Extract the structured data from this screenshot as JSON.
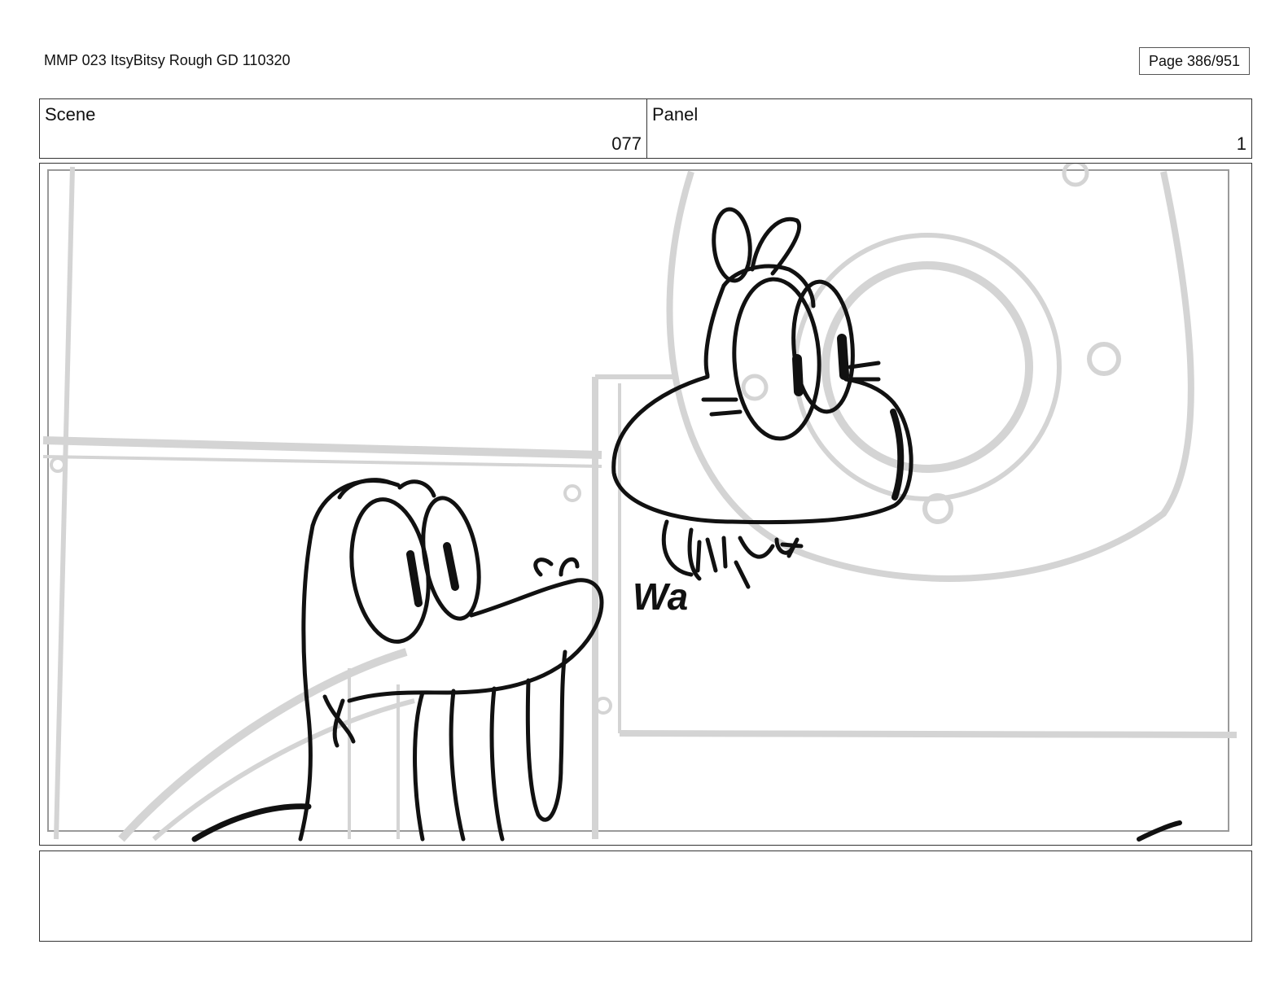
{
  "document": {
    "title": "MMP 023 ItsyBitsy Rough GD 110320",
    "page_label": "Page 386/951"
  },
  "header": {
    "scene_label": "Scene",
    "scene_value": "077",
    "panel_label": "Panel",
    "panel_value": "1"
  },
  "drawing": {
    "sound_effect_text": "Wa",
    "colors": {
      "background_lines": "#d6d6d6",
      "ink": "#111111",
      "frame": "#333333"
    }
  },
  "notes": {
    "text": ""
  }
}
